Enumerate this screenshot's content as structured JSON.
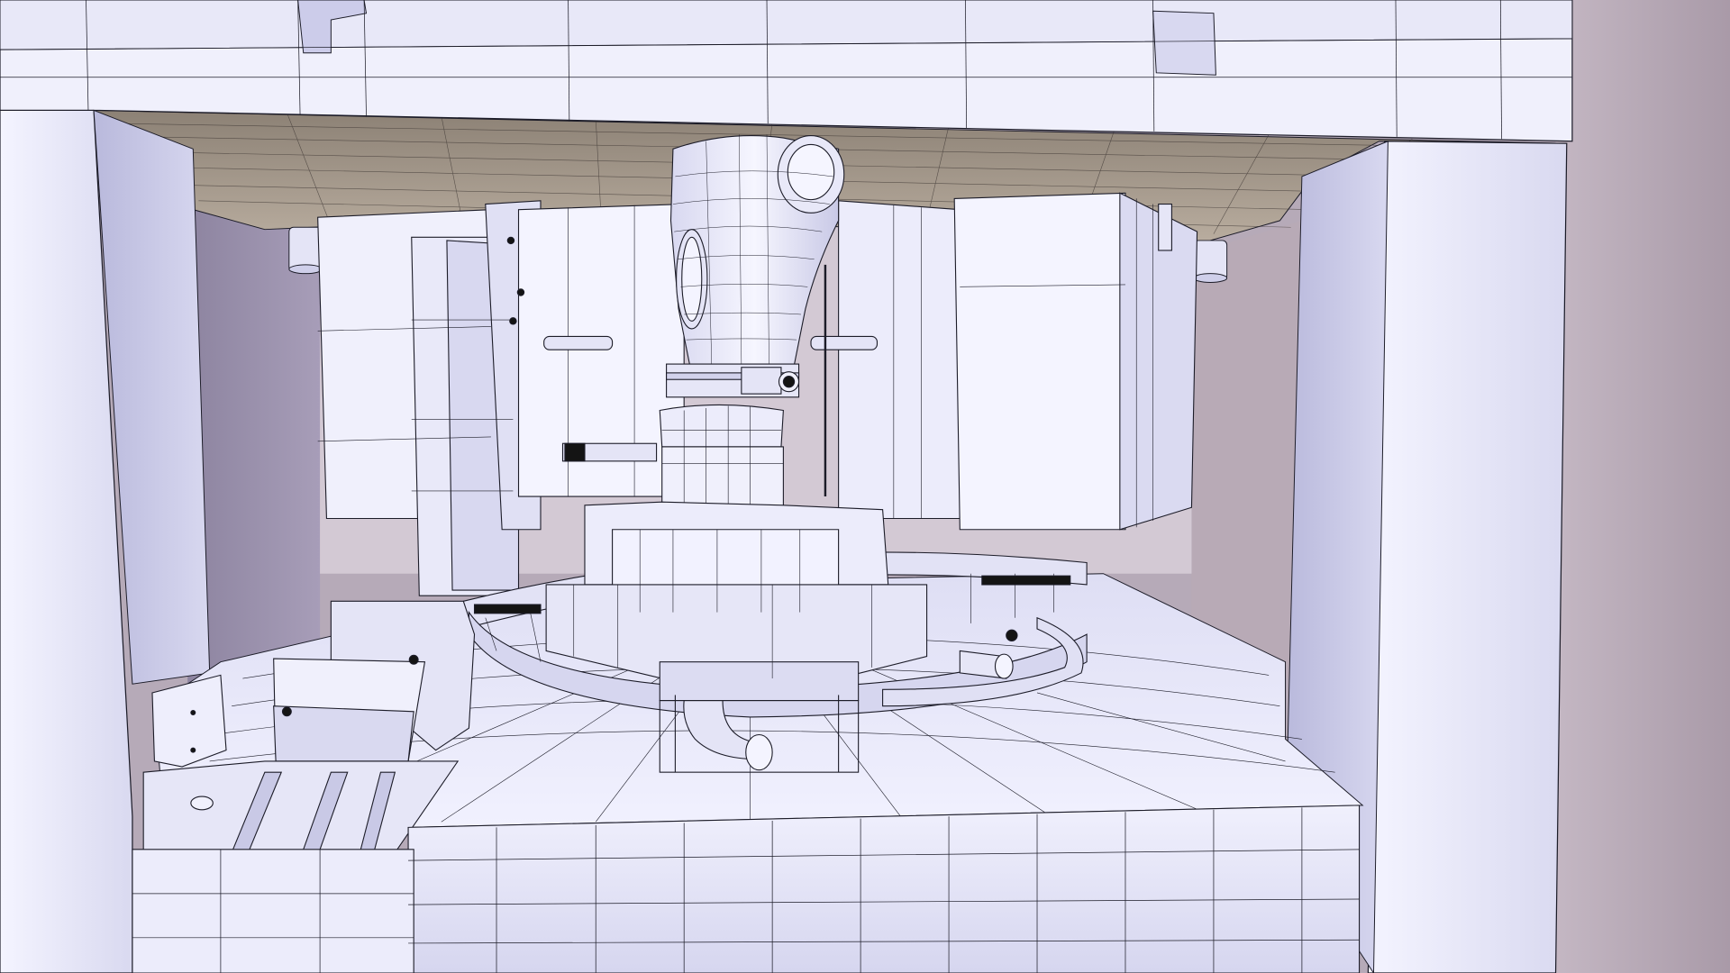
{
  "scene": {
    "label": "",
    "palette": {
      "face_light": "#eeeefc",
      "face_mid": "#dcdcf2",
      "face_shade": "#c3c3e3",
      "wall_left": "#9c93ad",
      "wall_right": "#b3a7b4",
      "ceiling": "#a49a8f",
      "backdrop": "#cfc3cf",
      "edge": "#1c1c28",
      "dark_part": "#141414"
    },
    "components": [
      {
        "name": "frame-top-beam",
        "icon": "beam"
      },
      {
        "name": "frame-left-column",
        "icon": "column"
      },
      {
        "name": "frame-right-column",
        "icon": "column"
      },
      {
        "name": "ceiling-grid",
        "icon": "grid"
      },
      {
        "name": "left-housing",
        "icon": "box"
      },
      {
        "name": "right-housing",
        "icon": "box"
      },
      {
        "name": "central-hopper-column",
        "icon": "hopper"
      },
      {
        "name": "rotary-turret-ring",
        "icon": "ring"
      },
      {
        "name": "discharge-chute",
        "icon": "pipe"
      },
      {
        "name": "side-pipe-outlet",
        "icon": "pipe"
      },
      {
        "name": "feeder-tray",
        "icon": "tray"
      },
      {
        "name": "conveyor-rails",
        "icon": "rails"
      },
      {
        "name": "control-knob",
        "icon": "knob"
      },
      {
        "name": "front-base-block",
        "icon": "base"
      },
      {
        "name": "radial-platform",
        "icon": "platform"
      }
    ]
  }
}
